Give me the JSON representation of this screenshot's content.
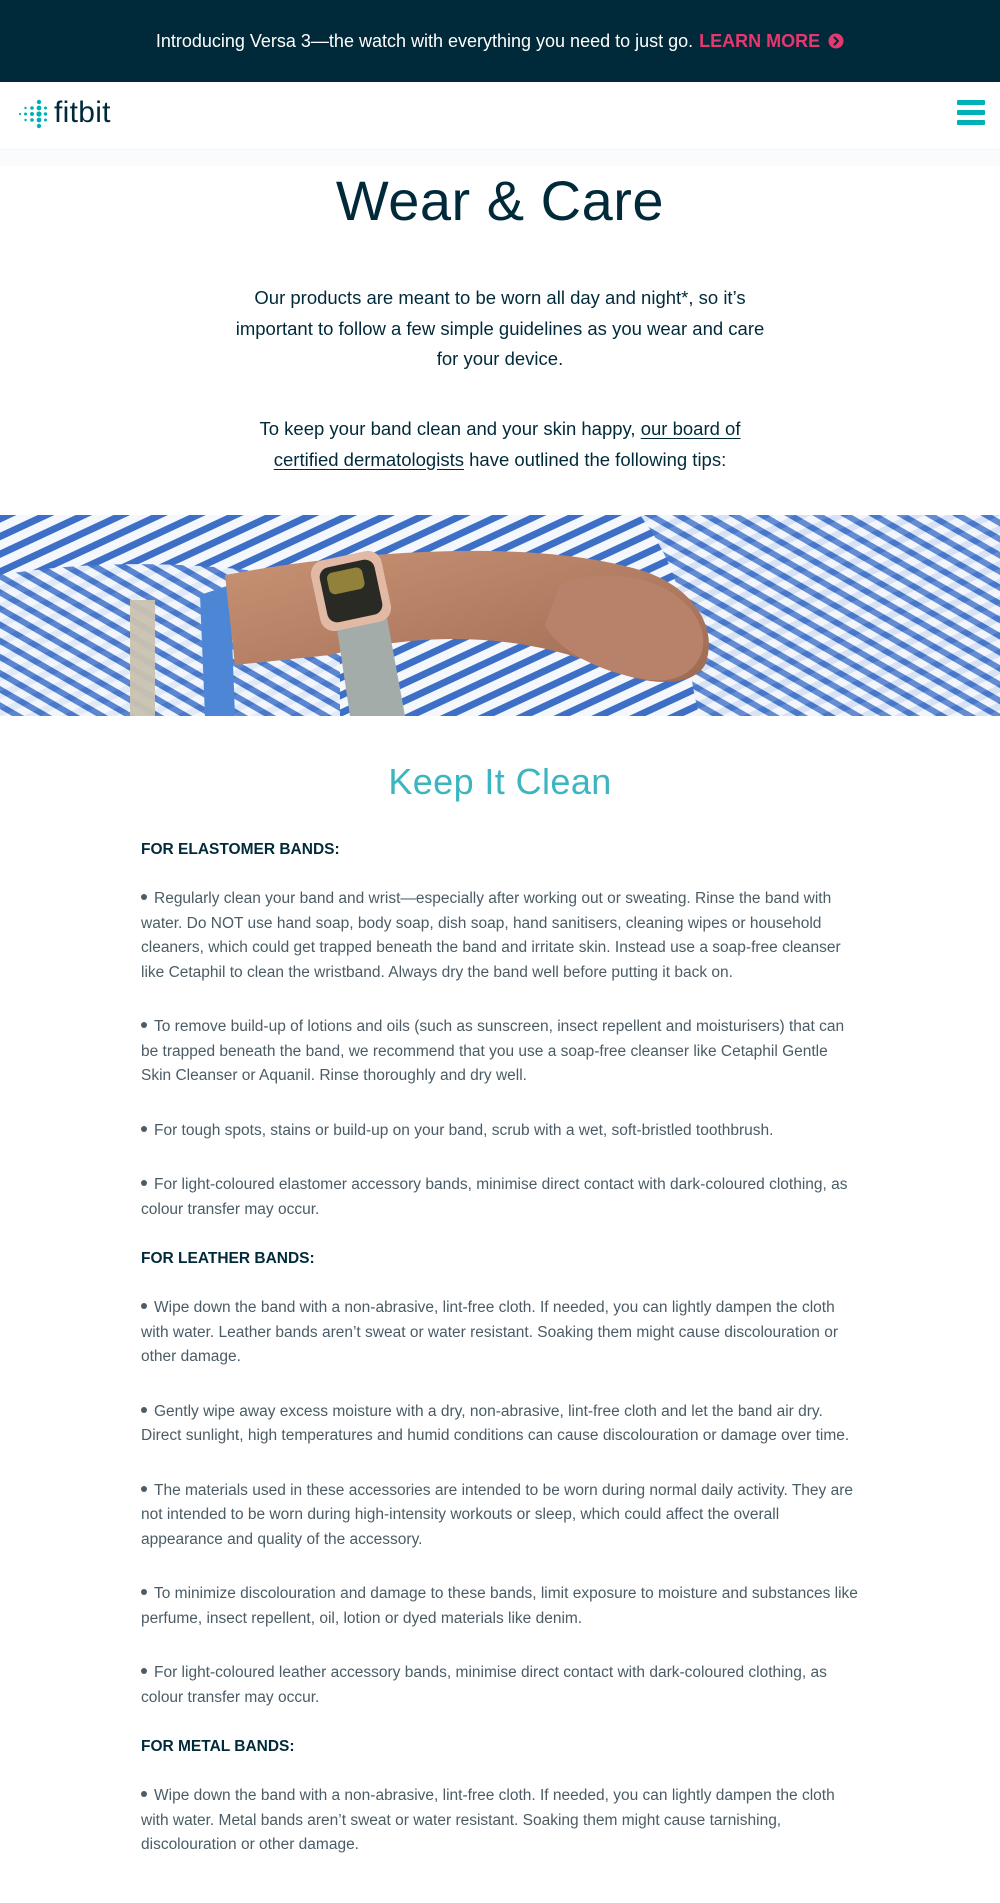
{
  "promo": {
    "text": "Introducing Versa 3—the watch with everything you need to just go.",
    "link_label": "LEARN MORE",
    "link_icon": "chevron-circle-right-icon",
    "background": "#002a3a",
    "accent": "#e4386f"
  },
  "header": {
    "logo_text": "fitbit",
    "logo_icon": "fitbit-dots-icon",
    "menu_icon": "hamburger-menu-icon",
    "brand_color": "#00b0b9"
  },
  "page": {
    "title": "Wear & Care",
    "intro": "Our products are meant to be worn all day and night*, so it’s important to follow a few simple guidelines as you wear and care for your device.",
    "intro2_before": "To keep your band clean and your skin happy, ",
    "intro2_link": "our board of certified dermatologists",
    "intro2_after": " have outlined the following tips:"
  },
  "hero": {
    "image": "wrist-wearing-smartwatch-striped-shirt"
  },
  "section": {
    "title": "Keep It Clean",
    "title_color": "#3bb6c0",
    "groups": [
      {
        "heading": "FOR ELASTOMER BANDS:",
        "tips": [
          "Regularly clean your band and wrist—especially after working out or sweating. Rinse the band with water. Do NOT use hand soap, body soap, dish soap, hand sanitisers, cleaning wipes or household cleaners, which could get trapped beneath the band and irritate skin. Instead use a soap-free cleanser like Cetaphil to clean the wristband. Always dry the band well before putting it back on.",
          "To remove build-up of lotions and oils (such as sunscreen, insect repellent and moisturisers) that can be trapped beneath the band, we recommend that you use a soap-free cleanser like Cetaphil Gentle Skin Cleanser or Aquanil. Rinse thoroughly and dry well.",
          "For tough spots, stains or build-up on your band, scrub with a wet, soft-bristled toothbrush.",
          "For light-coloured elastomer accessory bands, minimise direct contact with dark-coloured clothing, as colour transfer may occur."
        ]
      },
      {
        "heading": "FOR LEATHER BANDS:",
        "tips": [
          "Wipe down the band with a non-abrasive, lint-free cloth. If needed, you can lightly dampen the cloth with water. Leather bands aren’t sweat or water resistant. Soaking them might cause discolouration or other damage.",
          "Gently wipe away excess moisture with a dry, non-abrasive, lint-free cloth and let the band air dry. Direct sunlight, high temperatures and humid conditions can cause discolouration or damage over time.",
          "The materials used in these accessories are intended to be worn during normal daily activity. They are not intended to be worn during high-intensity workouts or sleep, which could affect the overall appearance and quality of the accessory.",
          "To minimize discolouration and damage to these bands, limit exposure to moisture and substances like perfume, insect repellent, oil, lotion or dyed materials like denim.",
          "For light-coloured leather accessory bands, minimise direct contact with dark-coloured clothing, as colour transfer may occur."
        ]
      },
      {
        "heading": "FOR METAL BANDS:",
        "tips": [
          "Wipe down the band with a non-abrasive, lint-free cloth. If needed, you can lightly dampen the cloth with water. Metal bands aren’t sweat or water resistant. Soaking them might cause tarnishing, discolouration or other damage."
        ]
      }
    ]
  }
}
